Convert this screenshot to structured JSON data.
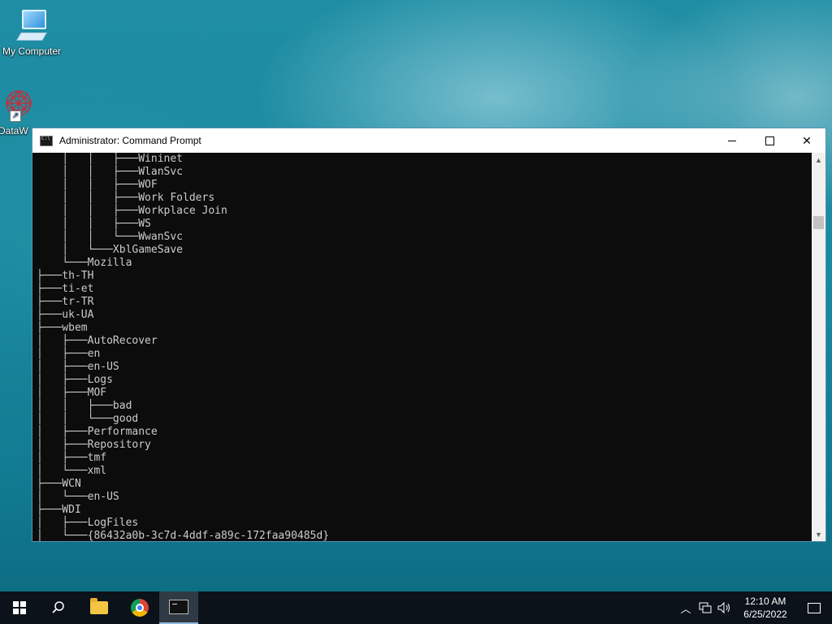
{
  "desktop": {
    "icons": [
      {
        "label": "My Computer"
      },
      {
        "label": "DataW"
      }
    ]
  },
  "window": {
    "title": "Administrator: Command Prompt",
    "console_lines": [
      "    │   │   ├───Wininet",
      "    │   │   ├───WlanSvc",
      "    │   │   ├───WOF",
      "    │   │   ├───Work Folders",
      "    │   │   ├───Workplace Join",
      "    │   │   ├───WS",
      "    │   │   └───WwanSvc",
      "    │   └───XblGameSave",
      "    └───Mozilla",
      "├───th-TH",
      "├───ti-et",
      "├───tr-TR",
      "├───uk-UA",
      "├───wbem",
      "│   ├───AutoRecover",
      "│   ├───en",
      "│   ├───en-US",
      "│   ├───Logs",
      "│   ├───MOF",
      "│   │   ├───bad",
      "│   │   └───good",
      "│   ├───Performance",
      "│   ├───Repository",
      "│   ├───tmf",
      "│   └───xml",
      "├───WCN",
      "│   └───en-US",
      "├───WDI",
      "│   ├───LogFiles",
      "│   └───{86432a0b-3c7d-4ddf-a89c-172faa90485d}"
    ]
  },
  "taskbar": {
    "buttons": [
      "start",
      "search",
      "file-explorer",
      "chrome",
      "command-prompt"
    ],
    "clock": {
      "time": "12:10 AM",
      "date": "6/25/2022"
    }
  },
  "colors": {
    "console_bg": "#0c0c0c",
    "console_fg": "#cccccc",
    "taskbar_bg": "#0b1219"
  }
}
